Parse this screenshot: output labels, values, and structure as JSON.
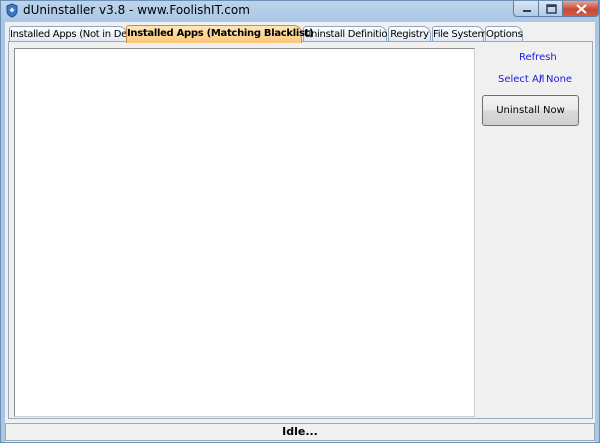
{
  "window": {
    "title": "dUninstaller v3.8   -   www.FoolishIT.com",
    "controls": {
      "minimize_icon": "minimize-icon",
      "maximize_icon": "maximize-icon",
      "close_icon": "close-icon"
    }
  },
  "tabs": [
    {
      "label": "Installed Apps (Not in Defs)",
      "active": false
    },
    {
      "label": "Installed Apps (Matching Blacklist)",
      "active": true
    },
    {
      "label": "Uninstall Definitions",
      "active": false
    },
    {
      "label": "Registry",
      "active": false
    },
    {
      "label": "File System",
      "active": false
    },
    {
      "label": "Options",
      "active": false
    }
  ],
  "sidepanel": {
    "refresh_label": "Refresh",
    "select_all_label": "Select All",
    "separator": "/",
    "none_label": "None",
    "uninstall_button_label": "Uninstall Now"
  },
  "listbox": {
    "items": []
  },
  "status": {
    "text": "Idle..."
  },
  "colors": {
    "active_tab": "#fbc878",
    "link": "#1a1ad8",
    "window_frame": "#a9c6e3"
  }
}
